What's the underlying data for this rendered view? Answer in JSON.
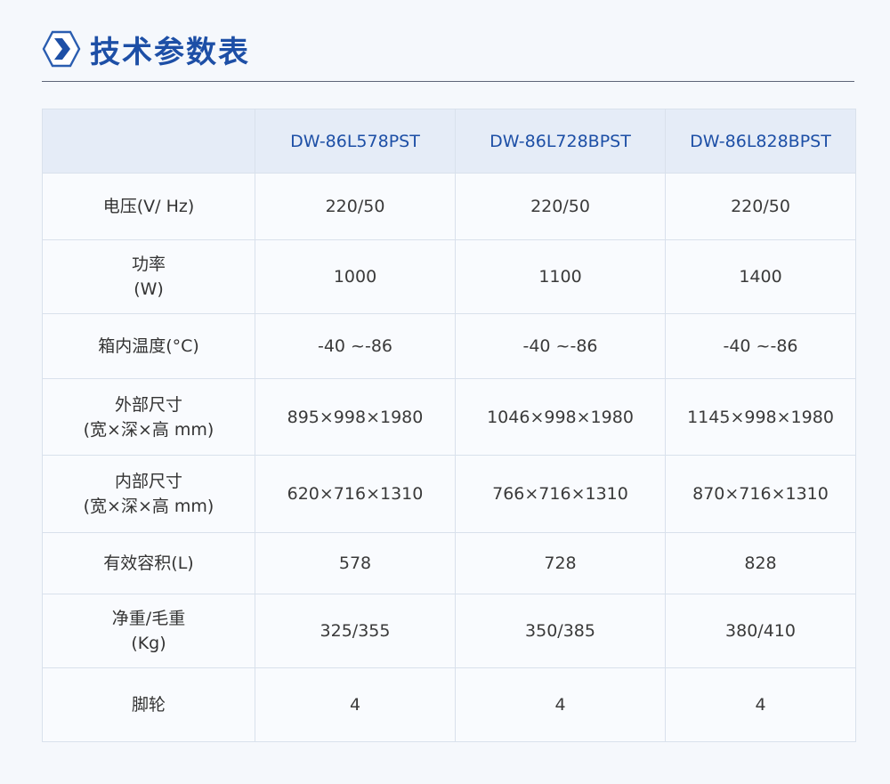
{
  "header": {
    "title": "技术参数表",
    "accent_color": "#1d4fa6",
    "icon": "hexagon-chevron-right-icon"
  },
  "table": {
    "columns": [
      "",
      "DW-86L578PST",
      "DW-86L728BPST",
      "DW-86L828BPST"
    ],
    "rows": [
      {
        "label": [
          "电压(V/ Hz)"
        ],
        "values": [
          "220/50",
          "220/50",
          "220/50"
        ]
      },
      {
        "label": [
          "功率",
          "(W)"
        ],
        "values": [
          "1000",
          "1100",
          "1400"
        ]
      },
      {
        "label": [
          "箱内温度(°C)"
        ],
        "values": [
          "-40 ~-86",
          "-40 ~-86",
          "-40 ~-86"
        ]
      },
      {
        "label": [
          "外部尺寸",
          "(宽×深×高 mm)"
        ],
        "values": [
          "895×998×1980",
          "1046×998×1980",
          "1145×998×1980"
        ]
      },
      {
        "label": [
          "内部尺寸",
          "(宽×深×高 mm)"
        ],
        "values": [
          "620×716×1310",
          "766×716×1310",
          "870×716×1310"
        ]
      },
      {
        "label": [
          "有效容积(L)"
        ],
        "values": [
          "578",
          "728",
          "828"
        ]
      },
      {
        "label": [
          "净重/毛重",
          "(Kg)"
        ],
        "values": [
          "325/355",
          "350/385",
          "380/410"
        ]
      },
      {
        "label": [
          "脚轮"
        ],
        "values": [
          "4",
          "4",
          "4"
        ]
      }
    ]
  }
}
